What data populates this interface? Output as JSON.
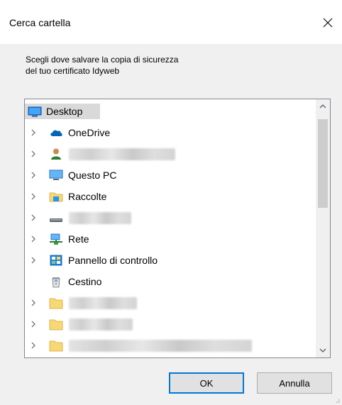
{
  "window": {
    "title": "Cerca cartella",
    "close_icon": "close-icon"
  },
  "instruction": {
    "line1": "Scegli dove salvare la copia di sicurezza",
    "line2": "del tuo certificato Idyweb"
  },
  "tree": {
    "root": {
      "label": "Desktop",
      "icon": "desktop-icon",
      "selected": true
    },
    "items": [
      {
        "label": "OneDrive",
        "icon": "onedrive-cloud-icon",
        "expandable": true
      },
      {
        "label": "",
        "icon": "user-icon",
        "expandable": true,
        "redacted": true
      },
      {
        "label": "Questo PC",
        "icon": "this-pc-icon",
        "expandable": true
      },
      {
        "label": "Raccolte",
        "icon": "libraries-icon",
        "expandable": true
      },
      {
        "label": "",
        "icon": "drive-icon",
        "expandable": true,
        "redacted": true
      },
      {
        "label": "Rete",
        "icon": "network-icon",
        "expandable": true
      },
      {
        "label": "Pannello di controllo",
        "icon": "control-panel-icon",
        "expandable": true
      },
      {
        "label": "Cestino",
        "icon": "recycle-bin-icon",
        "expandable": false
      },
      {
        "label": "",
        "icon": "folder-icon",
        "expandable": true,
        "redacted": true
      },
      {
        "label": "",
        "icon": "folder-icon",
        "expandable": true,
        "redacted": true
      },
      {
        "label": "",
        "icon": "folder-icon",
        "expandable": true,
        "redacted": true
      }
    ]
  },
  "buttons": {
    "ok": "OK",
    "cancel": "Annulla"
  },
  "colors": {
    "accent": "#0078d7",
    "selection": "#d9d9d9",
    "folder": "#f8d775",
    "onedrive": "#0364b8"
  }
}
